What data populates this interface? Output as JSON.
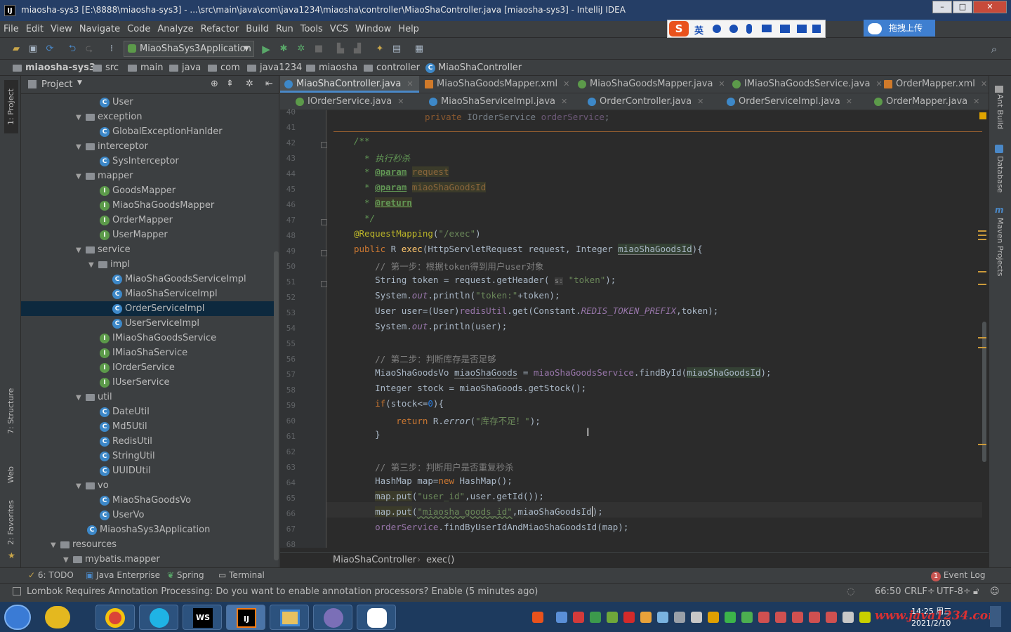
{
  "window": {
    "title": "miaosha-sys3 [E:\\8888\\miaosha-sys3] - ...\\src\\main\\java\\com\\java1234\\miaosha\\controller\\MiaoShaController.java [miaosha-sys3] - IntelliJ IDEA",
    "app_icon": "IJ"
  },
  "menu": [
    "File",
    "Edit",
    "View",
    "Navigate",
    "Code",
    "Analyze",
    "Refactor",
    "Build",
    "Run",
    "Tools",
    "VCS",
    "Window",
    "Help"
  ],
  "ime": {
    "label": "英",
    "cloud_label": "拖拽上传"
  },
  "toolbar": {
    "run_config": "MiaoShaSys3Application"
  },
  "breadcrumb": [
    "miaosha-sys3",
    "src",
    "main",
    "java",
    "com",
    "java1234",
    "miaosha",
    "controller",
    "MiaoShaController"
  ],
  "project": {
    "header": "Project",
    "tree": [
      {
        "label": "User",
        "type": "class",
        "level": 3
      },
      {
        "label": "exception",
        "type": "folder",
        "level": 2
      },
      {
        "label": "GlobalExceptionHanlder",
        "type": "class",
        "level": 3
      },
      {
        "label": "interceptor",
        "type": "folder",
        "level": 2
      },
      {
        "label": "SysInterceptor",
        "type": "class",
        "level": 3
      },
      {
        "label": "mapper",
        "type": "folder",
        "level": 2
      },
      {
        "label": "GoodsMapper",
        "type": "interface",
        "level": 3
      },
      {
        "label": "MiaoShaGoodsMapper",
        "type": "interface",
        "level": 3
      },
      {
        "label": "OrderMapper",
        "type": "interface",
        "level": 3
      },
      {
        "label": "UserMapper",
        "type": "interface",
        "level": 3
      },
      {
        "label": "service",
        "type": "folder",
        "level": 2
      },
      {
        "label": "impl",
        "type": "folder",
        "level": 3
      },
      {
        "label": "MiaoShaGoodsServiceImpl",
        "type": "class",
        "level": 4
      },
      {
        "label": "MiaoShaServiceImpl",
        "type": "class",
        "level": 4
      },
      {
        "label": "OrderServiceImpl",
        "type": "class",
        "level": 4,
        "selected": true
      },
      {
        "label": "UserServiceImpl",
        "type": "class",
        "level": 4
      },
      {
        "label": "IMiaoShaGoodsService",
        "type": "interface",
        "level": 3
      },
      {
        "label": "IMiaoShaService",
        "type": "interface",
        "level": 3
      },
      {
        "label": "IOrderService",
        "type": "interface",
        "level": 3
      },
      {
        "label": "IUserService",
        "type": "interface",
        "level": 3
      },
      {
        "label": "util",
        "type": "folder",
        "level": 2
      },
      {
        "label": "DateUtil",
        "type": "class",
        "level": 3
      },
      {
        "label": "Md5Util",
        "type": "class",
        "level": 3
      },
      {
        "label": "RedisUtil",
        "type": "class",
        "level": 3
      },
      {
        "label": "StringUtil",
        "type": "class",
        "level": 3
      },
      {
        "label": "UUIDUtil",
        "type": "class",
        "level": 3
      },
      {
        "label": "vo",
        "type": "folder",
        "level": 2
      },
      {
        "label": "MiaoShaGoodsVo",
        "type": "class",
        "level": 3
      },
      {
        "label": "UserVo",
        "type": "class",
        "level": 3
      },
      {
        "label": "MiaoshaSys3Application",
        "type": "class",
        "level": 2
      },
      {
        "label": "resources",
        "type": "folder",
        "level": 0
      },
      {
        "label": "mybatis.mapper",
        "type": "folder",
        "level": 1
      }
    ]
  },
  "tabs_row1": [
    {
      "label": "MiaoShaController.java",
      "active": true
    },
    {
      "label": "MiaoShaGoodsMapper.xml"
    },
    {
      "label": "MiaoShaGoodsMapper.java"
    },
    {
      "label": "IMiaoShaGoodsService.java"
    },
    {
      "label": "OrderMapper.xml"
    }
  ],
  "tabs_row2": [
    {
      "label": "IOrderService.java"
    },
    {
      "label": "MiaoShaServiceImpl.java"
    },
    {
      "label": "OrderController.java"
    },
    {
      "label": "OrderServiceImpl.java"
    },
    {
      "label": "OrderMapper.java"
    }
  ],
  "code": {
    "line_numbers": [
      "40",
      "41",
      "42",
      "43",
      "44",
      "45",
      "46",
      "47",
      "48",
      "49",
      "50",
      "51",
      "52",
      "53",
      "54",
      "55",
      "56",
      "57",
      "58",
      "59",
      "60",
      "61",
      "62",
      "63",
      "64",
      "65",
      "66",
      "67",
      "68"
    ]
  },
  "editor_crumb": [
    "MiaoShaController",
    "exec()"
  ],
  "right_tools": [
    "Ant Build",
    "Database",
    "Maven Projects"
  ],
  "left_tools": [
    "1: Project",
    "7: Structure",
    "Web",
    "2: Favorites"
  ],
  "bottom_tools": [
    "6: TODO",
    "Java Enterprise",
    "Spring",
    "Terminal"
  ],
  "event_log": {
    "label": "Event Log",
    "count": "1"
  },
  "status": {
    "message": "Lombok Requires Annotation Processing: Do you want to enable annotation processors? Enable (5 minutes ago)",
    "position": "66:50",
    "line_sep": "CRLF÷",
    "encoding": "UTF-8÷"
  },
  "clock": {
    "time": "14:25 周三",
    "date": "2021/2/10"
  },
  "watermark": "www.java1234.com",
  "colors": {
    "accent": "#4a88c7",
    "selected_row": "#0d293e",
    "editor_bg": "#2b2b2b",
    "panel_bg": "#3c3f41",
    "title_bg": "#253e66"
  }
}
